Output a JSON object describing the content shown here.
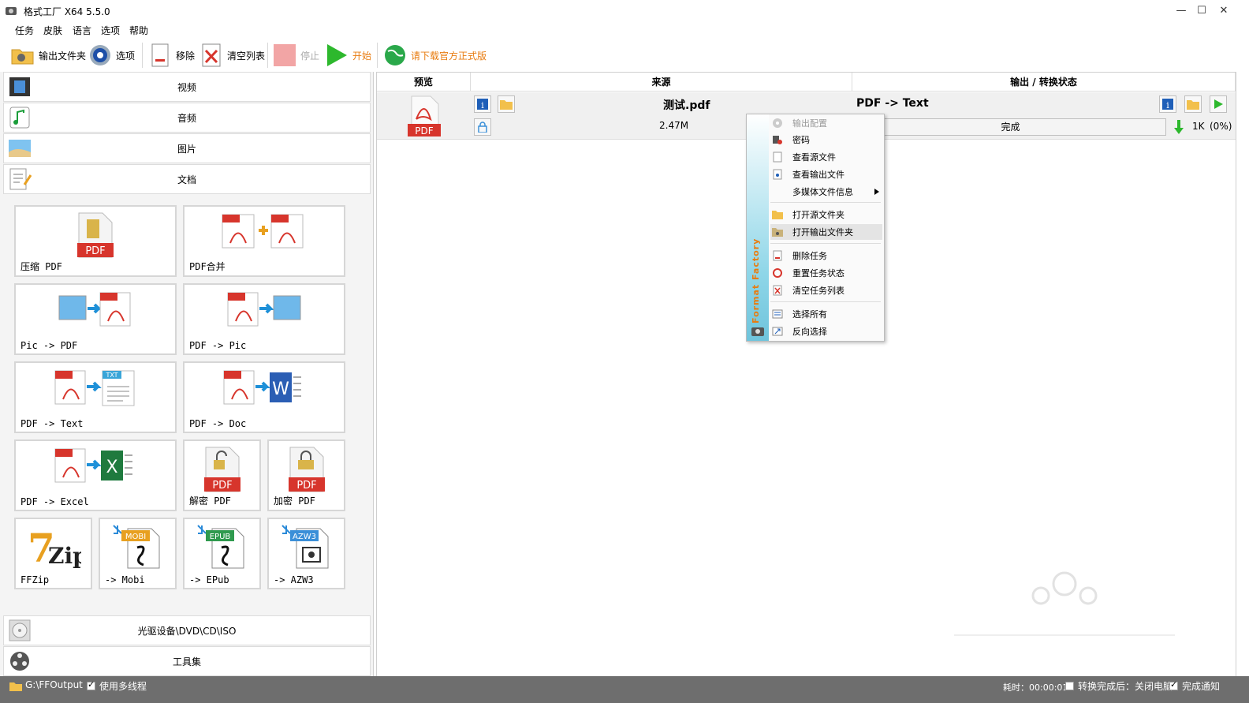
{
  "window": {
    "title": "格式工厂 X64 5.5.0",
    "minimize": "—",
    "maximize": "☐",
    "close": "✕"
  },
  "menu": [
    "任务",
    "皮肤",
    "语言",
    "选项",
    "帮助"
  ],
  "toolbar": {
    "output_folder": "输出文件夹",
    "options": "选项",
    "remove": "移除",
    "clear_list": "清空列表",
    "stop": "停止",
    "start": "开始",
    "download": "请下载官方正式版"
  },
  "categories": {
    "video": "视频",
    "audio": "音频",
    "picture": "图片",
    "document": "文档",
    "disc": "光驱设备\\DVD\\CD\\ISO",
    "tools": "工具集"
  },
  "doc_tools": [
    "压缩 PDF",
    "PDF合并",
    "Pic -> PDF",
    "PDF -> Pic",
    "PDF -> Text",
    "PDF -> Doc",
    "PDF -> Excel",
    "解密 PDF",
    "加密 PDF",
    "FFZip",
    "-> Mobi",
    "-> EPub",
    "-> AZW3"
  ],
  "icon_text": {
    "pdf": "PDF",
    "txt": "TXT",
    "word": "W",
    "excel": "X",
    "mobi": "MOBI",
    "epub": "EPUB",
    "azw3": "AZW3",
    "zip": "Zip"
  },
  "columns": {
    "preview": "预览",
    "source": "来源",
    "output": "输出 / 转换状态"
  },
  "task": {
    "filename": "测试.pdf",
    "size": "2.47M",
    "conversion": "PDF -> Text",
    "status": "完成",
    "output_size": "1K",
    "ratio": "(0%)",
    "preview_label": "PDF"
  },
  "context_menu": {
    "brand": "Format Factory",
    "items": [
      {
        "label": "输出配置",
        "disabled": true
      },
      {
        "label": "密码"
      },
      {
        "label": "查看源文件"
      },
      {
        "label": "查看输出文件"
      },
      {
        "label": "多媒体文件信息",
        "submenu": true
      },
      {
        "label": "打开源文件夹"
      },
      {
        "label": "打开输出文件夹",
        "highlighted": true
      },
      {
        "label": "删除任务"
      },
      {
        "label": "重置任务状态"
      },
      {
        "label": "清空任务列表"
      },
      {
        "label": "选择所有"
      },
      {
        "label": "反向选择"
      }
    ]
  },
  "statusbar": {
    "output_path": "G:\\FFOutput",
    "multithread": "使用多线程",
    "elapsed": "耗时：00:00:01",
    "after_convert": "转换完成后：关闭电脑",
    "notify": "完成通知"
  },
  "colors": {
    "accent_orange": "#e87c10",
    "pdf_red": "#d7352c",
    "status_bar": "#6e6e6e",
    "start_green": "#2db82d"
  }
}
